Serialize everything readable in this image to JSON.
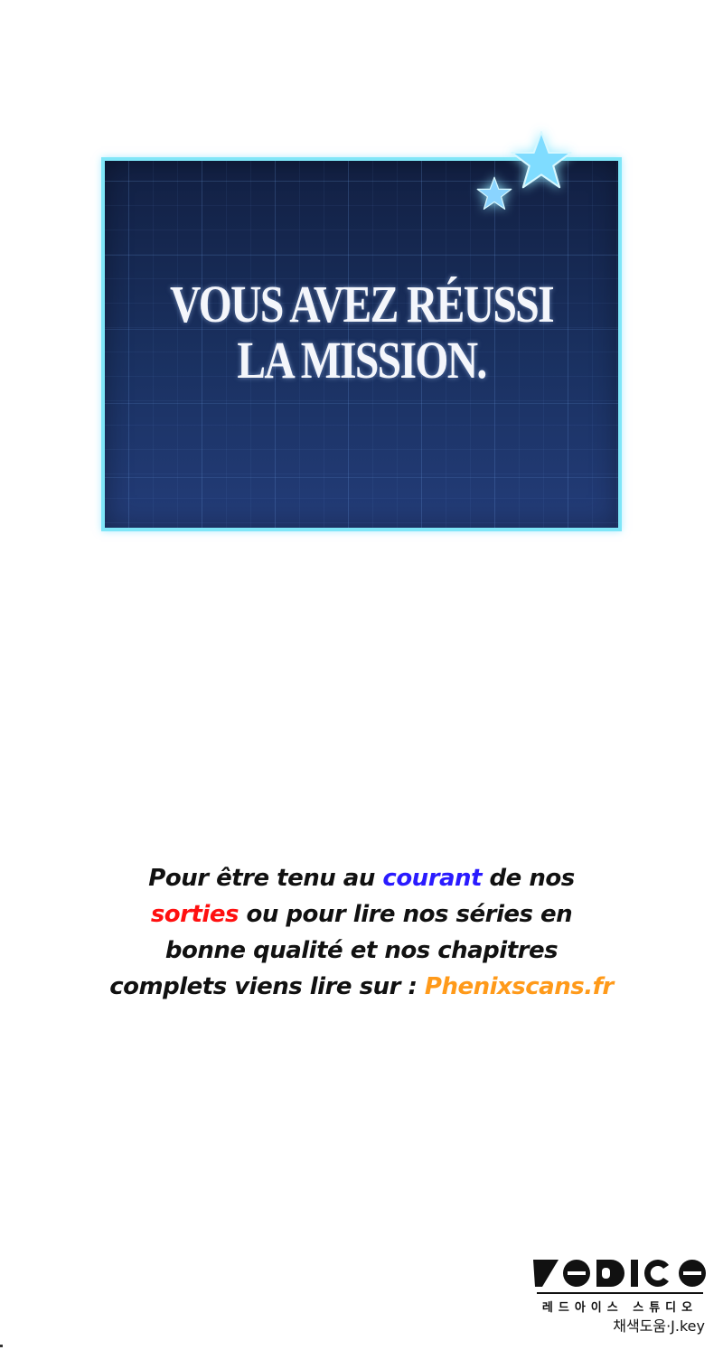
{
  "mission_panel": {
    "line1": "VOUS AVEZ RÉUSSI",
    "line2": "LA MISSION.",
    "border_color": "#7fe6f8",
    "background_color": "#1a3161",
    "star_color": "#7fdcff"
  },
  "promo": {
    "part1": "Pour être tenu au ",
    "highlight_courant": "courant",
    "part2": " de nos",
    "highlight_sorties": "sorties",
    "part3": " ou pour lire nos séries en bonne qualité et nos chapitres complets viens lire sur : ",
    "highlight_site": "Phenixscans.fr",
    "colors": {
      "blue": "#2a1bff",
      "red": "#ff1010",
      "orange": "#ff9a1a"
    }
  },
  "studio_logo": {
    "korean_name": "레드아이스 스튜디오",
    "mark_text": "REDICE"
  },
  "credit": {
    "text": "채색도움·J.key"
  }
}
